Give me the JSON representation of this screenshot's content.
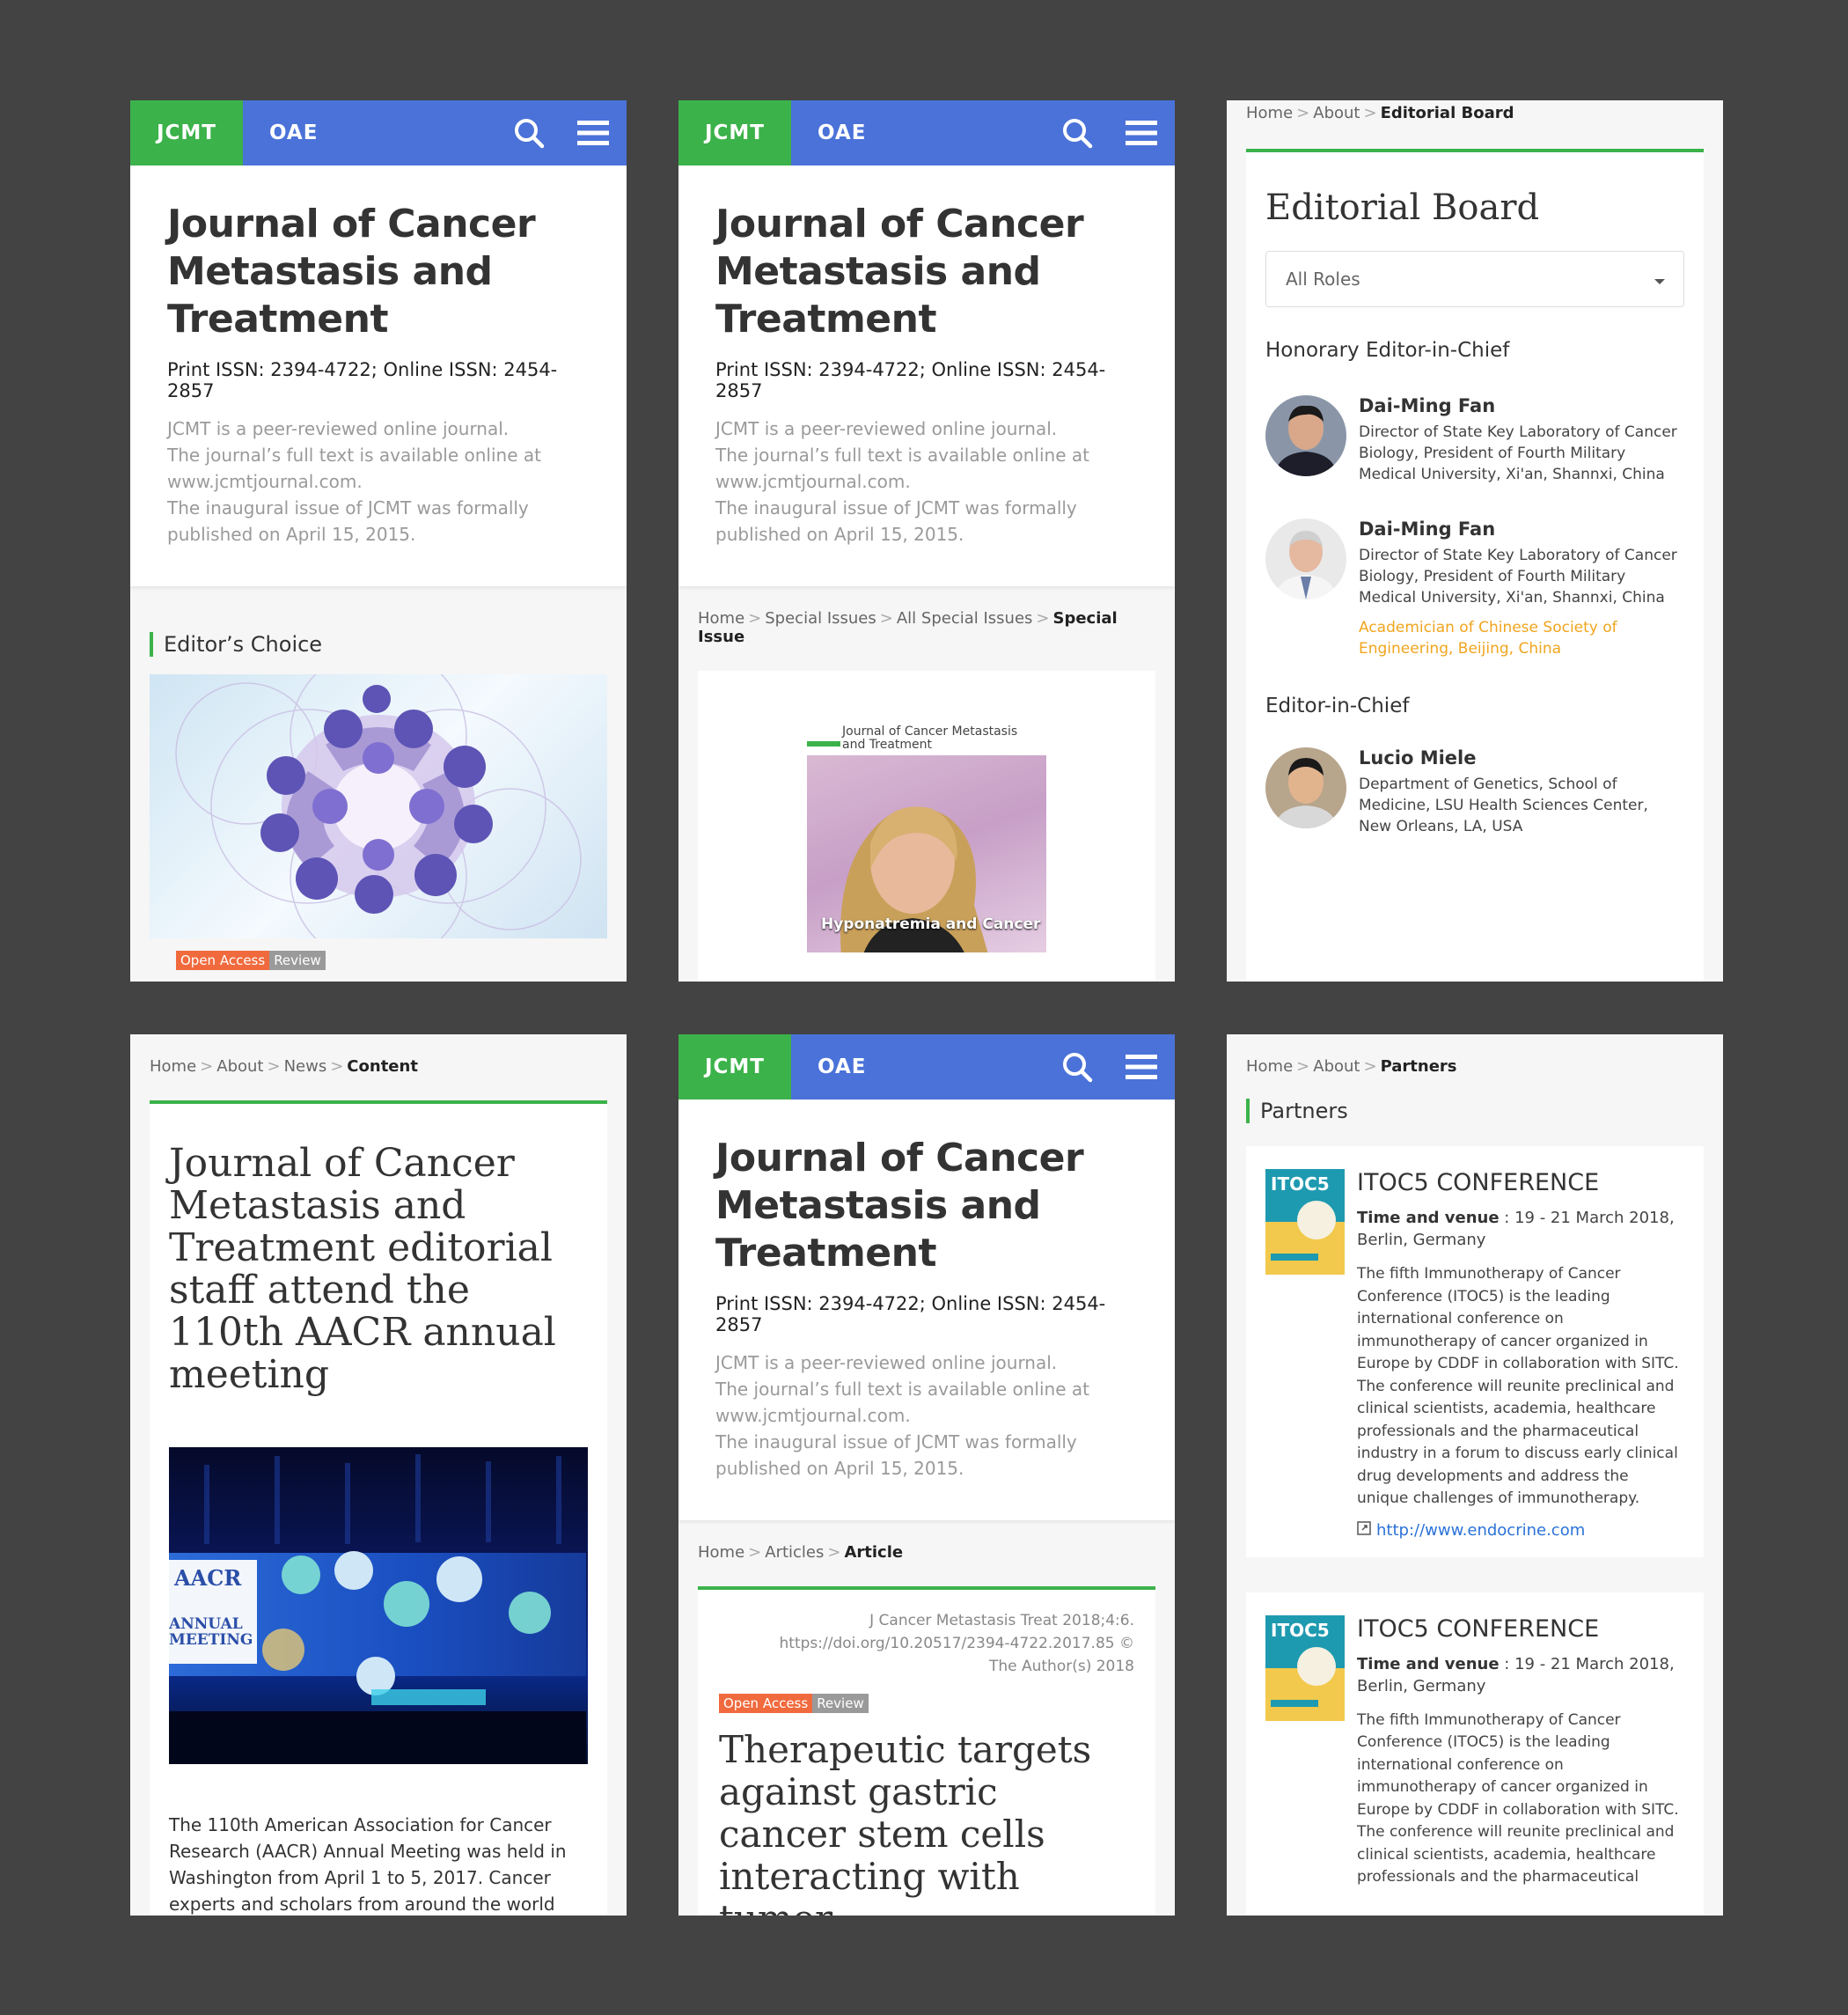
{
  "brand": "JCMT",
  "org": "OAE",
  "journal": {
    "title": "Journal of Cancer Metastasis and Treatment",
    "issn": "Print ISSN: 2394-4722; Online ISSN: 2454-2857",
    "desc1": "JCMT is a peer-reviewed online journal.",
    "desc2": "The journal’s full text is available online at www.jcmtjournal.com.",
    "desc3": "The inaugural issue of JCMT was formally published on April 15, 2015."
  },
  "tags": {
    "open_access": "Open Access",
    "review": "Review"
  },
  "screen1": {
    "section": "Editor’s Choice"
  },
  "screen2": {
    "crumbs": [
      "Home",
      "Special Issues",
      "All Special Issues"
    ],
    "current": "Special Issue",
    "cover_journal": "Journal of Cancer Metastasis and Treatment",
    "cover_title": "Hyponatremia and Cancer"
  },
  "screen3": {
    "crumbs": [
      "Home",
      "About"
    ],
    "current": "Editorial Board",
    "title": "Editorial Board",
    "select": "All Roles",
    "role1": "Honorary Editor-in-Chief",
    "role2": "Editor-in-Chief",
    "people": [
      {
        "name": "Dai-Ming Fan",
        "aff": "Director of State Key Laboratory of Cancer Biology, President of Fourth Military Medical University, Xi'an, Shannxi, China",
        "aff2": ""
      },
      {
        "name": "Dai-Ming Fan",
        "aff": "Director of State Key Laboratory of Cancer Biology, President of Fourth Military Medical University, Xi'an, Shannxi, China",
        "aff2": "Academician of Chinese Society of Engineering, Beijing, China"
      },
      {
        "name": "Lucio Miele",
        "aff": "Department of Genetics, School of Medicine, LSU Health Sciences Center, New Orleans, LA, USA",
        "aff2": ""
      }
    ]
  },
  "screen4": {
    "crumbs": [
      "Home",
      "About",
      "News"
    ],
    "current": "Content",
    "title": "Journal of Cancer Metastasis and Treatment editorial staff attend the 110th AACR annual meeting",
    "banner_line1": "AACR",
    "banner_line2": "ANNUAL",
    "banner_line3": "MEETING",
    "body": "The 110th American Association for Cancer Research (AACR) Annual Meeting was held in Washington from April 1 to 5, 2017. Cancer experts and scholars from around the world"
  },
  "screen5": {
    "crumbs": [
      "Home",
      "Articles"
    ],
    "current": "Article",
    "citation": "J Cancer Metastasis Treat 2018;4:6. https://doi.org/10.20517/2394-4722.2017.85 © The Author(s) 2018",
    "title": "Therapeutic targets against gastric cancer stem cells interacting with tumor"
  },
  "screen6": {
    "crumbs": [
      "Home",
      "About"
    ],
    "current": "Partners",
    "section": "Partners",
    "partners": [
      {
        "name": "ITOC5 CONFERENCE",
        "label": "Time and venue",
        "venue": " : 19 - 21 March 2018, Berlin, Germany",
        "desc": "The fifth Immunotherapy of Cancer Conference (ITOC5) is the leading international conference on immunotherapy of cancer organized in Europe by CDDF in collaboration with SITC. The conference will reunite preclinical and clinical scientists, academia, healthcare professionals and the pharmaceutical industry in a forum to discuss early clinical drug developments and address the unique challenges of immunotherapy.",
        "link": "http://www.endocrine.com"
      },
      {
        "name": "ITOC5 CONFERENCE",
        "label": "Time and venue",
        "venue": " : 19 - 21 March 2018, Berlin, Germany",
        "desc": "The fifth Immunotherapy of Cancer Conference (ITOC5) is the leading international conference on immunotherapy of cancer organized in Europe by CDDF in collaboration with SITC. The conference will reunite preclinical and clinical scientists, academia, healthcare professionals and the pharmaceutical",
        "link": ""
      }
    ]
  },
  "colors": {
    "green": "#3cb24a",
    "blue": "#4a72d8",
    "orange": "#f06a3d",
    "gold": "#f0a51e",
    "link": "#2b72d8"
  }
}
